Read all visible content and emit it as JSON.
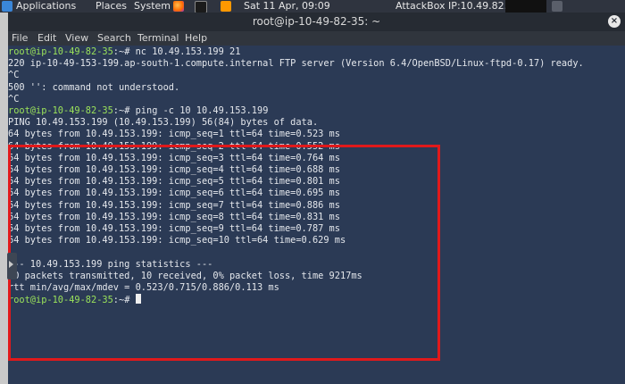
{
  "topbar": {
    "applications": "Applications",
    "places": "Places",
    "system": "System",
    "datetime": "Sat 11 Apr, 09:09",
    "attackbox": "AttackBox IP:10.49.82.35"
  },
  "window": {
    "title": "root@ip-10-49-82-35: ~",
    "close_label": "×"
  },
  "menubar": {
    "items": [
      "File",
      "Edit",
      "View",
      "Search",
      "Terminal",
      "Help"
    ]
  },
  "terminal": {
    "lines": [
      {
        "prompt": "root@ip-10-49-82-35",
        "suffix": ":~# ",
        "text": "nc 10.49.153.199 21"
      },
      {
        "text": "220 ip-10-49-153-199.ap-south-1.compute.internal FTP server (Version 6.4/OpenBSD/Linux-ftpd-0.17) ready."
      },
      {
        "text": "^C"
      },
      {
        "text": "500 '': command not understood."
      },
      {
        "text": "^C"
      },
      {
        "prompt": "root@ip-10-49-82-35",
        "suffix": ":~# ",
        "text": "ping -c 10 10.49.153.199"
      },
      {
        "text": "PING 10.49.153.199 (10.49.153.199) 56(84) bytes of data."
      },
      {
        "text": "64 bytes from 10.49.153.199: icmp_seq=1 ttl=64 time=0.523 ms"
      },
      {
        "text": "64 bytes from 10.49.153.199: icmp_seq=2 ttl=64 time=0.552 ms"
      },
      {
        "text": "64 bytes from 10.49.153.199: icmp_seq=3 ttl=64 time=0.764 ms"
      },
      {
        "text": "64 bytes from 10.49.153.199: icmp_seq=4 ttl=64 time=0.688 ms"
      },
      {
        "text": "64 bytes from 10.49.153.199: icmp_seq=5 ttl=64 time=0.801 ms"
      },
      {
        "text": "64 bytes from 10.49.153.199: icmp_seq=6 ttl=64 time=0.695 ms"
      },
      {
        "text": "64 bytes from 10.49.153.199: icmp_seq=7 ttl=64 time=0.886 ms"
      },
      {
        "text": "64 bytes from 10.49.153.199: icmp_seq=8 ttl=64 time=0.831 ms"
      },
      {
        "text": "64 bytes from 10.49.153.199: icmp_seq=9 ttl=64 time=0.787 ms"
      },
      {
        "text": "64 bytes from 10.49.153.199: icmp_seq=10 ttl=64 time=0.629 ms"
      },
      {
        "text": ""
      },
      {
        "text": "--- 10.49.153.199 ping statistics ---"
      },
      {
        "text": "10 packets transmitted, 10 received, 0% packet loss, time 9217ms"
      },
      {
        "text": "rtt min/avg/max/mdev = 0.523/0.715/0.886/0.113 ms"
      },
      {
        "prompt": "root@ip-10-49-82-35",
        "suffix": ":~# ",
        "text": "",
        "cursor": true
      }
    ]
  },
  "colors": {
    "terminal_bg": "#2b3a55",
    "prompt": "#9be35a",
    "highlight": "#e0191b"
  },
  "icons": [
    "applications-icon",
    "firefox-icon",
    "terminal-icon",
    "sublime-text-icon",
    "terminal-window-icon",
    "close-icon",
    "expand-arrow-icon"
  ]
}
